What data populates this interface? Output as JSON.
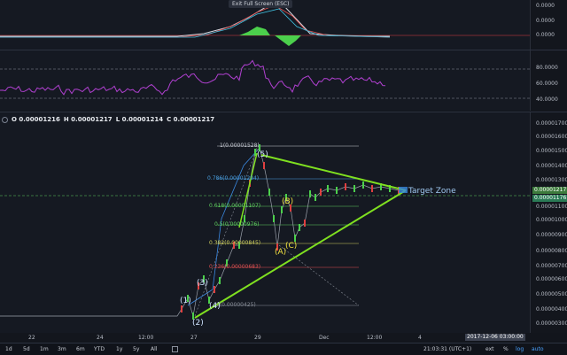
{
  "fullscreen_tip": "Exit Full Screen (ESC)",
  "ohlc": {
    "o": "O 0.00001216",
    "h": "H 0.00001217",
    "l": "L 0.00001214",
    "c": "C 0.00001217"
  },
  "pane1_ticks": [
    "0.0000",
    "0.0000",
    "0.0000"
  ],
  "pane2_ticks": [
    "80.0000",
    "60.0000",
    "40.0000"
  ],
  "price_ticks": [
    "0.00001700",
    "0.00001600",
    "0.00001500",
    "0.00001400",
    "0.00001300",
    "0.00001100",
    "0.00001000",
    "0.00000900",
    "0.00000800",
    "0.00000700",
    "0.00000600",
    "0.00000500",
    "0.00000400",
    "0.00000300"
  ],
  "price_chip_a": "0.00001217",
  "price_chip_b": "0.00001176",
  "fib": [
    {
      "label": "1(0.00001528)",
      "color": "#c8ccd4"
    },
    {
      "label": "0.786(0.00001294)",
      "color": "#4a9fe0"
    },
    {
      "label": "0.618(0.00001107)",
      "color": "#5fd05f"
    },
    {
      "label": "0.5(0.00000976)",
      "color": "#5fd05f"
    },
    {
      "label": "0.382(0.00000845)",
      "color": "#d0d05f"
    },
    {
      "label": "0.236(0.00000683)",
      "color": "#e05050"
    },
    {
      "label": "0(0.00000425)",
      "color": "#8a8f99"
    }
  ],
  "waves": [
    "(1)",
    "(2)",
    "(3)",
    "(4)",
    "(5)",
    "(A)",
    "(B)",
    "(C)"
  ],
  "target_zone": "Target Zone",
  "x_ticks": [
    "22",
    "24",
    "12:00",
    "27",
    "29",
    "Dec",
    "12:00",
    "4"
  ],
  "date_chip": "2017-12-06 03:00:00",
  "toolbar": {
    "ranges": [
      "1d",
      "5d",
      "1m",
      "3m",
      "6m",
      "YTD",
      "1y",
      "5y",
      "All"
    ],
    "time": "21:03:31 (UTC+1)",
    "ext": "ext",
    "pct": "%",
    "log": "log",
    "auto": "auto"
  }
}
